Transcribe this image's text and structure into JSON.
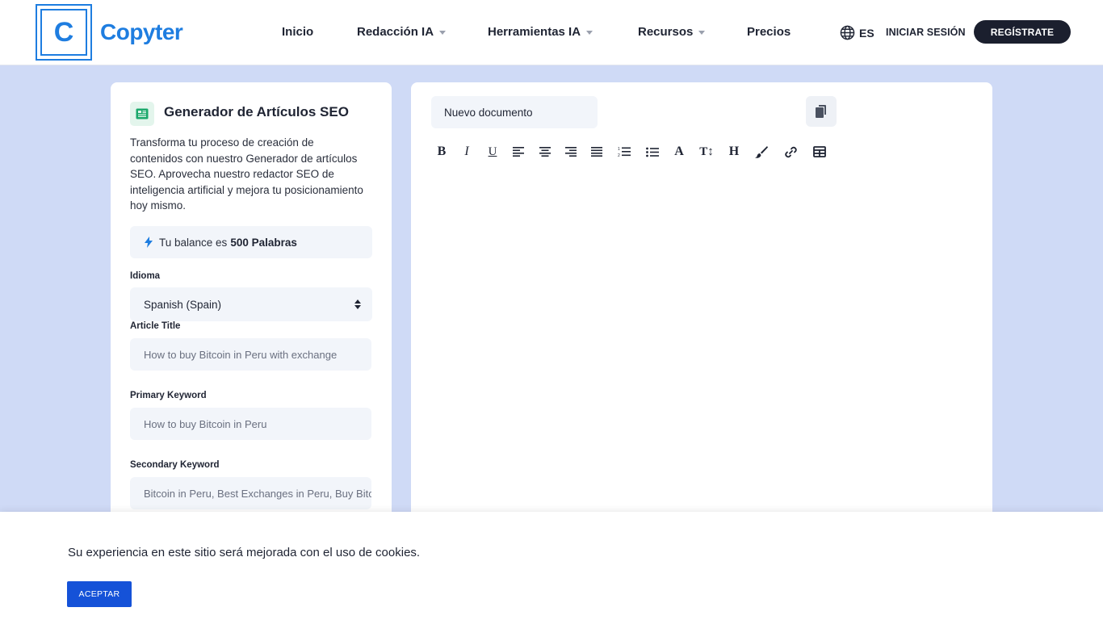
{
  "brand": {
    "logo_letter": "C",
    "name": "Copyter",
    "color": "#1e7de0"
  },
  "nav": {
    "items": [
      {
        "label": "Inicio",
        "has_dropdown": false
      },
      {
        "label": "Redacción IA",
        "has_dropdown": true
      },
      {
        "label": "Herramientas IA",
        "has_dropdown": true
      },
      {
        "label": "Recursos",
        "has_dropdown": true
      },
      {
        "label": "Precios",
        "has_dropdown": false
      }
    ],
    "language": "ES",
    "login_label": "INICIAR SESIÓN",
    "signup_label": "REGÍSTRATE"
  },
  "tool": {
    "title": "Generador de Artículos SEO",
    "icon": "newspaper-icon",
    "description": "Transforma tu proceso de creación de contenidos con nuestro Generador de artículos SEO. Aprovecha nuestro redactor SEO de inteligencia artificial y mejora tu posicionamiento hoy mismo.",
    "balance_prefix": "Tu balance es",
    "balance_value": "500 Palabras",
    "fields": {
      "language_label": "Idioma",
      "language_value": "Spanish (Spain)",
      "title_label": "Article Title",
      "title_placeholder": "How to buy Bitcoin in Peru with exchange",
      "primary_label": "Primary Keyword",
      "primary_placeholder": "How to buy Bitcoin in Peru",
      "secondary_label": "Secondary Keyword",
      "secondary_placeholder": "Bitcoin in Peru, Best Exchanges in Peru, Buy Bitcoin"
    }
  },
  "editor": {
    "document_name": "Nuevo documento",
    "toolbar": [
      "bold-icon",
      "italic-icon",
      "underline-icon",
      "align-left-icon",
      "align-center-icon",
      "align-right-icon",
      "align-justify-icon",
      "ordered-list-icon",
      "bullet-list-icon",
      "font-color-icon",
      "font-size-icon",
      "heading-icon",
      "brush-icon",
      "link-icon",
      "table-icon"
    ]
  },
  "cookie": {
    "text": "Su experiencia en este sitio será mejorada con el uso de cookies.",
    "accept_label": "ACEPTAR"
  }
}
